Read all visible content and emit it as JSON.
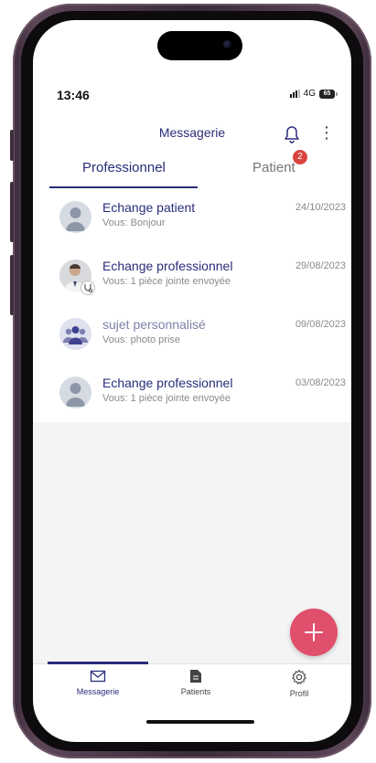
{
  "status_bar": {
    "time": "13:46",
    "network": "4G",
    "battery": "65"
  },
  "header": {
    "title": "Messagerie"
  },
  "tabs": [
    {
      "label": "Professionnel",
      "active": true
    },
    {
      "label": "Patient",
      "badge": "2"
    }
  ],
  "conversations": [
    {
      "title": "Echange patient",
      "subtitle": "Vous: Bonjour",
      "date": "24/10/2023",
      "avatar": "default-person-icon"
    },
    {
      "title": "Echange professionnel",
      "subtitle": "Vous: 1 pièce jointe envoyée",
      "date": "29/08/2023",
      "avatar": "doctor-photo"
    },
    {
      "title": "sujet personnalisé",
      "subtitle": "Vous: photo prise",
      "date": "09/08/2023",
      "avatar": "group-icon"
    },
    {
      "title": "Echange professionnel",
      "subtitle": "Vous: 1 pièce jointe envoyée",
      "date": "03/08/2023",
      "avatar": "default-person-icon"
    }
  ],
  "bottom_nav": [
    {
      "label": "Messagerie",
      "icon": "mail-icon",
      "active": true
    },
    {
      "label": "Patients",
      "icon": "document-icon"
    },
    {
      "label": "Profil",
      "icon": "gear-icon"
    }
  ],
  "colors": {
    "primary": "#2a2d7a",
    "badge": "#d9443f",
    "fab": "#e04f6b",
    "muted_text": "#8a8a8a",
    "background_empty": "#f4f4f4"
  }
}
